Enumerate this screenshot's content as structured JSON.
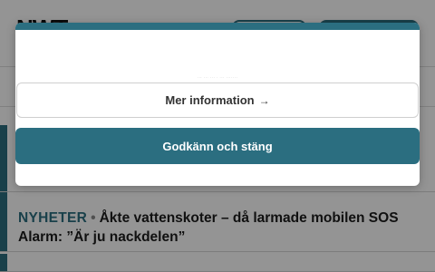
{
  "site": {
    "logo_text": "NWT"
  },
  "articles": [
    {
      "category": "NYHETER",
      "separator": "•",
      "headline": "Åkte vattenskoter – då larmade mobilen SOS Alarm: ”Är ju nackdelen”"
    }
  ],
  "consent_dialog": {
    "fineprint": "··· ··· ··· · ··· ·······",
    "more_info_label": "Mer information",
    "more_info_arrow": "→",
    "accept_label": "Godkänn och stäng"
  },
  "colors": {
    "accent": "#2b6e80",
    "overlay": "rgba(0,0,0,0.42)"
  },
  "icons": {
    "more_info_arrow": "arrow-right-icon"
  }
}
